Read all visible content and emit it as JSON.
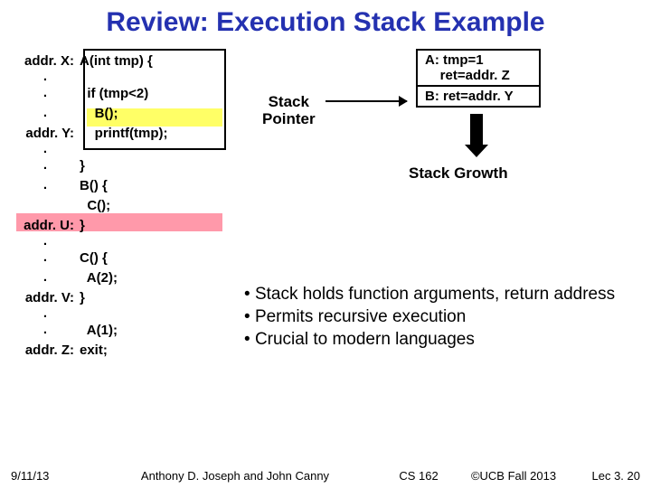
{
  "title": "Review: Execution Stack Example",
  "code": {
    "addrX": "addr. X:",
    "lineX": "A(int tmp) {",
    "lineIf": "  if (tmp<2)",
    "lineB": "    B();",
    "addrY": "addr. Y:",
    "lineY": "    printf(tmp);",
    "lineCloseA": "}",
    "lineBopen": "B() {",
    "lineCcall": "  C();",
    "addrU": "addr. U:",
    "lineCloseB": "}",
    "lineCopen": "C() {",
    "lineA2": "  A(2);",
    "addrV": "addr. V:",
    "lineCloseC": "}",
    "lineA1": "  A(1);",
    "addrZ": "addr. Z:",
    "lineExit": "exit;"
  },
  "frames": {
    "a": {
      "l1": "A: tmp=1",
      "l2": "    ret=addr. Z"
    },
    "b": {
      "l1": "B: ret=addr. Y"
    }
  },
  "stack_pointer": "Stack\nPointer",
  "growth": "Stack Growth",
  "bullets": [
    "Stack holds function arguments, return address",
    "Permits recursive execution",
    "Crucial to modern languages"
  ],
  "footer": {
    "date": "9/11/13",
    "authors": "Anthony D. Joseph and John Canny",
    "course": "CS 162",
    "copyright": "©UCB Fall 2013",
    "lec": "Lec 3. 20"
  }
}
